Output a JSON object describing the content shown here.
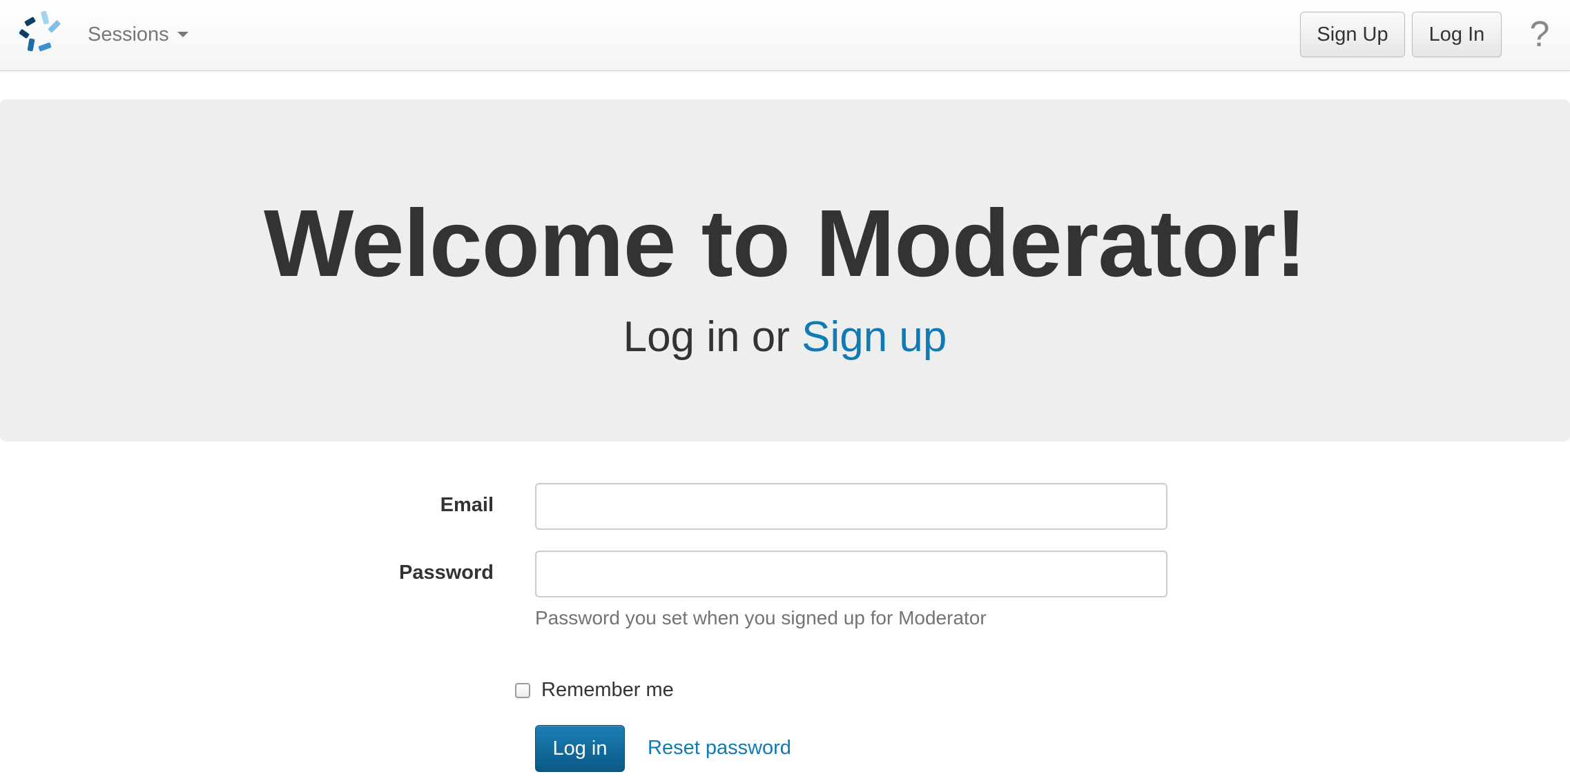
{
  "navbar": {
    "logo_icon": "moderator-spinner-logo-icon",
    "sessions_label": "Sessions",
    "sessions_caret_icon": "caret-down-icon",
    "signup_label": "Sign Up",
    "login_label": "Log In",
    "help_label": "?"
  },
  "hero": {
    "title": "Welcome to Moderator!",
    "subtitle_prefix": "Log in or ",
    "subtitle_link": "Sign up"
  },
  "form": {
    "email_label": "Email",
    "email_value": "",
    "password_label": "Password",
    "password_value": "",
    "password_help": "Password you set when you signed up for Moderator",
    "remember_label": "Remember me",
    "remember_checked": false,
    "submit_label": "Log in",
    "reset_label": "Reset password"
  },
  "colors": {
    "link": "#0f7ab3",
    "primary_button": "#0b5985",
    "hero_background": "#eeeeee",
    "logo_dark": "#0d3f66",
    "logo_mid": "#1b6fa8",
    "logo_light": "#7ec1e8"
  }
}
